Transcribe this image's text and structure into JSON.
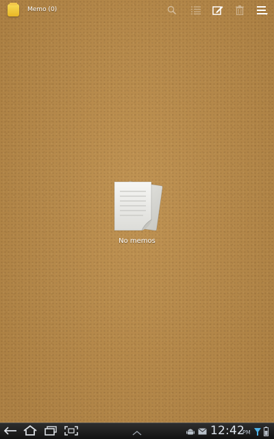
{
  "action_bar": {
    "title": "Memo (0)",
    "icons": [
      "memo-app-icon",
      "search-icon",
      "list-view-icon",
      "new-memo-icon",
      "delete-icon",
      "overflow-menu-icon"
    ]
  },
  "empty_state": {
    "label": "No memos",
    "icon": "memo-pages-icon"
  },
  "system_bar": {
    "time": "12:42",
    "ampm": "PM",
    "nav_icons": [
      "back-icon",
      "home-icon",
      "recent-apps-icon",
      "screenshot-icon",
      "chevron-up-icon"
    ],
    "status_icons": [
      "android-debug-icon",
      "email-notification-icon",
      "signal-icon",
      "battery-icon"
    ]
  },
  "colors": {
    "corkboard": "#b98b4a",
    "system_bar": "#1c1c1c",
    "text": "#ffffff",
    "clock_text": "#dfe6ef"
  }
}
